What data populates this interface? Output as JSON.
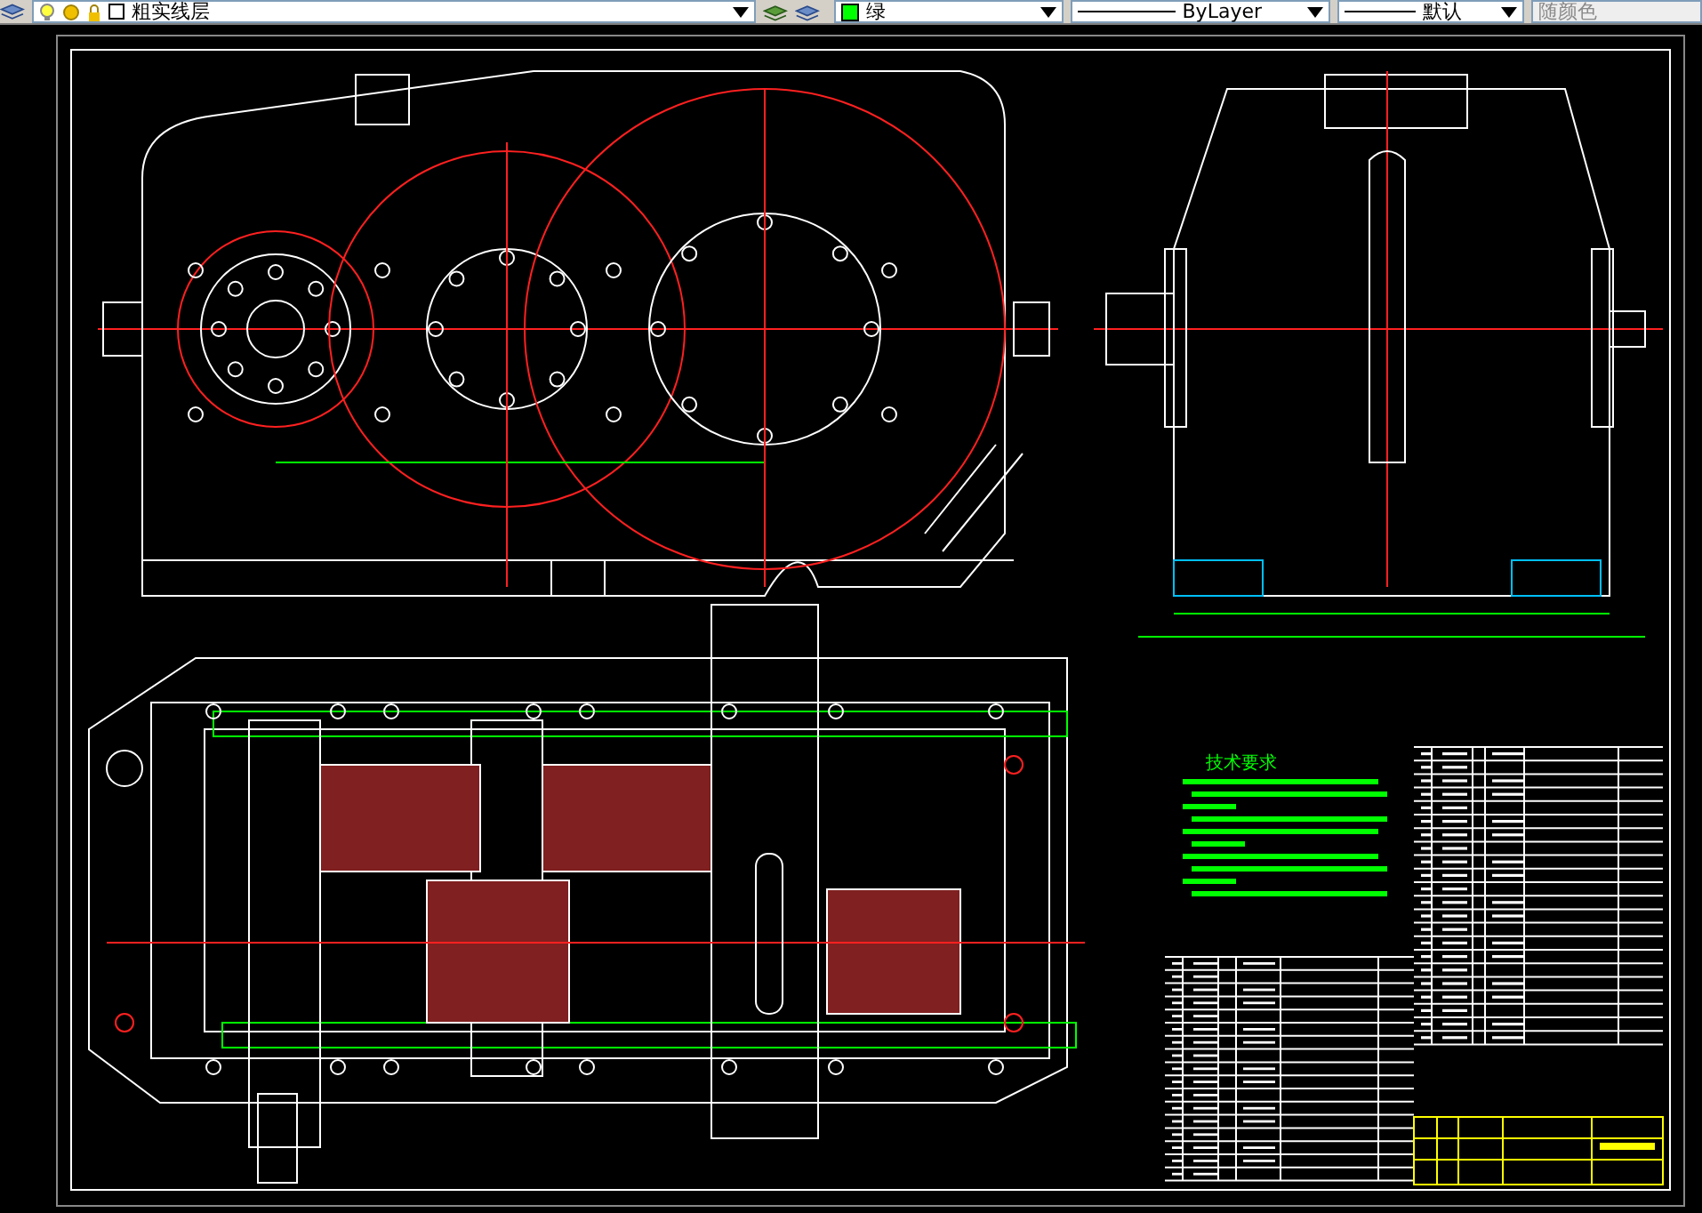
{
  "toolbar": {
    "layer_dropdown": {
      "value": "粗实线层"
    },
    "color_dropdown": {
      "value": "绿",
      "color": "#00ff00"
    },
    "linetype_dropdown": {
      "value": "ByLayer"
    },
    "lineweight_dropdown": {
      "value": "默认"
    },
    "plot_style_dropdown": {
      "value": "随颜色",
      "disabled": true
    }
  },
  "drawing": {
    "technical_requirements_title": "技术要求"
  }
}
